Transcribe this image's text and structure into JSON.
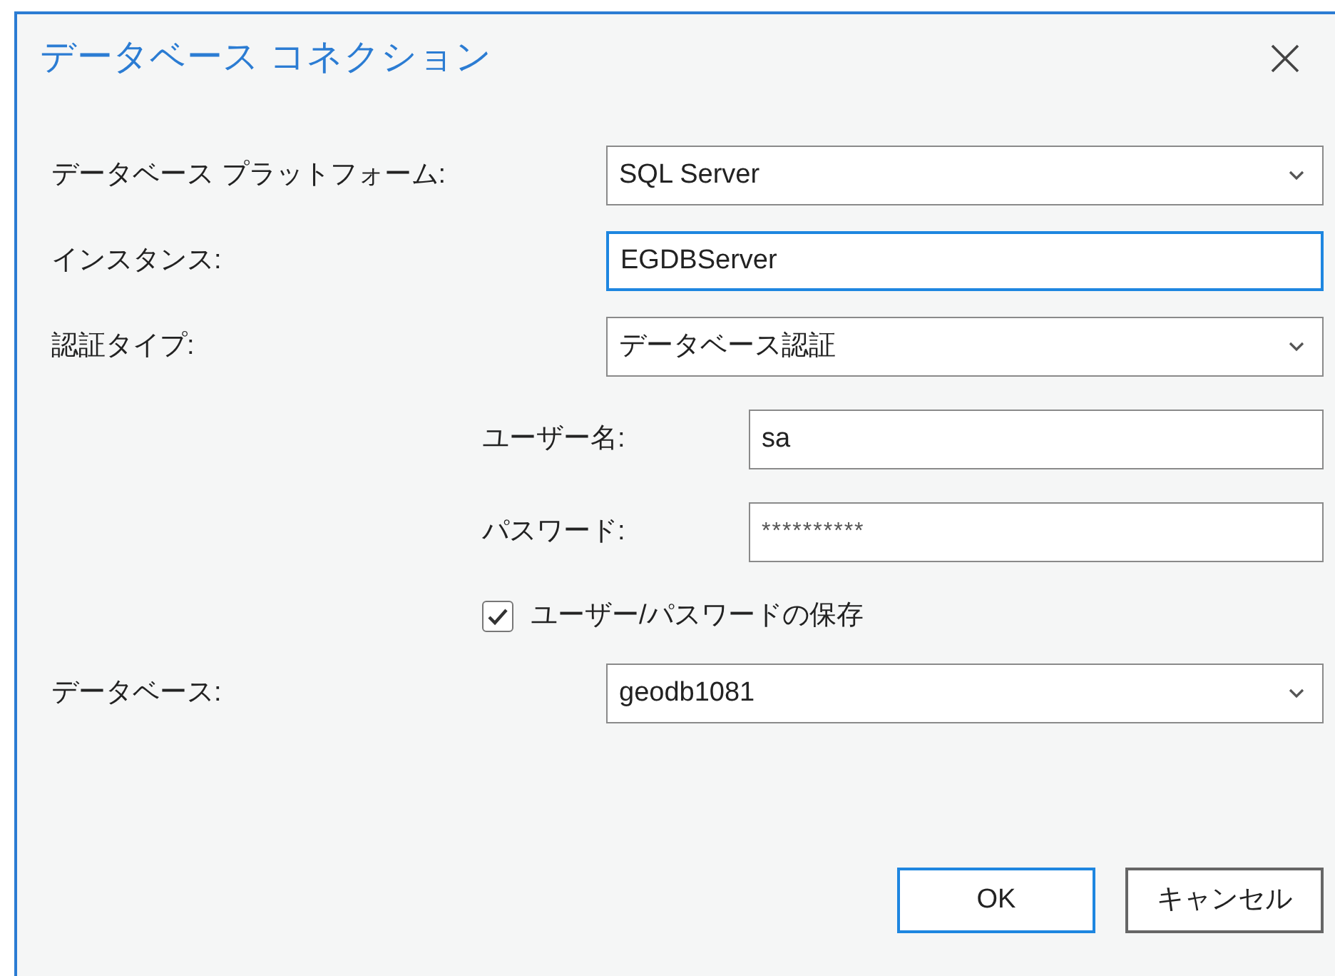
{
  "window": {
    "title": "データベース コネクション"
  },
  "fields": [
    {
      "kind": "dropdown",
      "label": "データベース プラットフォーム:",
      "value": "SQL Server",
      "focused": false
    },
    {
      "kind": "text",
      "label": "インスタンス:",
      "value": "EGDBServer",
      "focused": true
    },
    {
      "kind": "dropdown",
      "label": "認証タイプ:",
      "value": "データベース認証",
      "focused": false,
      "children": [
        {
          "kind": "text",
          "label": "ユーザー名:",
          "value": "sa",
          "focused": false
        },
        {
          "kind": "password",
          "label": "パスワード:",
          "value": "**********",
          "focused": false
        },
        {
          "kind": "checkbox",
          "label": "ユーザー/パスワードの保存",
          "checked": true
        }
      ]
    },
    {
      "kind": "dropdown",
      "label": "データベース:",
      "value": "geodb1081",
      "focused": false
    }
  ],
  "buttons": [
    {
      "label": "OK",
      "default": true
    },
    {
      "label": "キャンセル",
      "default": false
    }
  ]
}
